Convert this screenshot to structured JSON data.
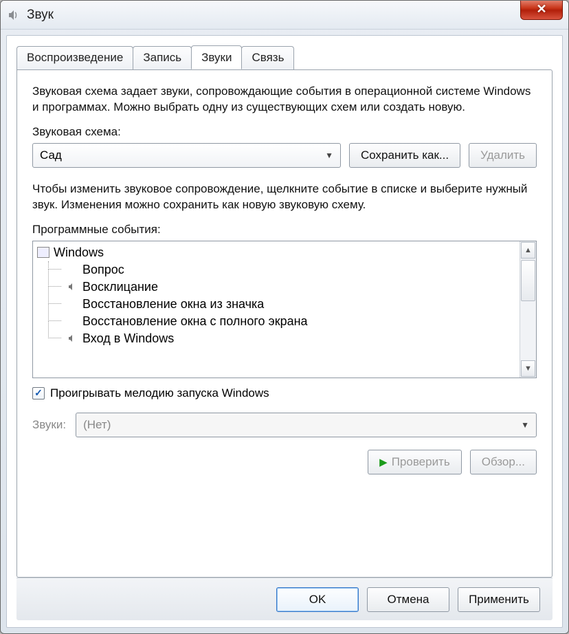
{
  "window": {
    "title": "Звук"
  },
  "tabs": [
    {
      "label": "Воспроизведение",
      "active": false
    },
    {
      "label": "Запись",
      "active": false
    },
    {
      "label": "Звуки",
      "active": true
    },
    {
      "label": "Связь",
      "active": false
    }
  ],
  "content": {
    "description": "Звуковая схема задает звуки, сопровождающие события в операционной системе Windows и программах. Можно выбрать одну из существующих схем или создать новую.",
    "scheme_label": "Звуковая схема:",
    "scheme_value": "Сад",
    "save_as_label": "Сохранить как...",
    "delete_label": "Удалить",
    "events_intro": "Чтобы изменить звуковое сопровождение, щелкните событие в списке и выберите нужный звук. Изменения можно сохранить как новую звуковую схему.",
    "events_label": "Программные события:",
    "tree_root": "Windows",
    "tree_items": [
      {
        "label": "Вопрос",
        "has_sound": false
      },
      {
        "label": "Восклицание",
        "has_sound": true
      },
      {
        "label": "Восстановление окна из значка",
        "has_sound": false
      },
      {
        "label": "Восстановление окна с полного экрана",
        "has_sound": false
      },
      {
        "label": "Вход в Windows",
        "has_sound": true
      }
    ],
    "play_startup_label": "Проигрывать мелодию запуска Windows",
    "play_startup_checked": true,
    "sounds_label": "Звуки:",
    "sounds_value": "(Нет)",
    "test_label": "Проверить",
    "browse_label": "Обзор..."
  },
  "dialog_buttons": {
    "ok": "OK",
    "cancel": "Отмена",
    "apply": "Применить"
  }
}
